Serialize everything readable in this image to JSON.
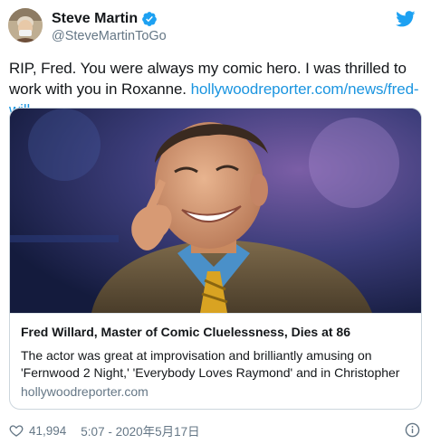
{
  "author": {
    "name": "Steve Martin",
    "handle": "@SteveMartinToGo",
    "verified": true,
    "avatar_icon": "avatar-photo"
  },
  "tweet": {
    "text": "RIP, Fred. You were always my comic hero. I was thrilled to work with you in Roxanne.",
    "link_text": "hollywoodreporter.com/news/fred-will…"
  },
  "card": {
    "image_alt_icon": "man-smiling-photo",
    "title": "Fred Willard, Master of Comic Cluelessness, Dies at 86",
    "description_line1": "The actor was great at improvisation and brilliantly amusing on",
    "description_line2": "'Fernwood 2 Night,' 'Everybody Loves Raymond' and in Christopher",
    "domain": "hollywoodreporter.com"
  },
  "footer": {
    "likes": "41,994",
    "timestamp": "5:07 - 2020年5月17日"
  },
  "colors": {
    "link": "#1b95e0",
    "secondary_text": "#657786",
    "primary_text": "#14171a",
    "twitter_blue": "#1da1f2",
    "card_border": "#ccd6dd"
  }
}
